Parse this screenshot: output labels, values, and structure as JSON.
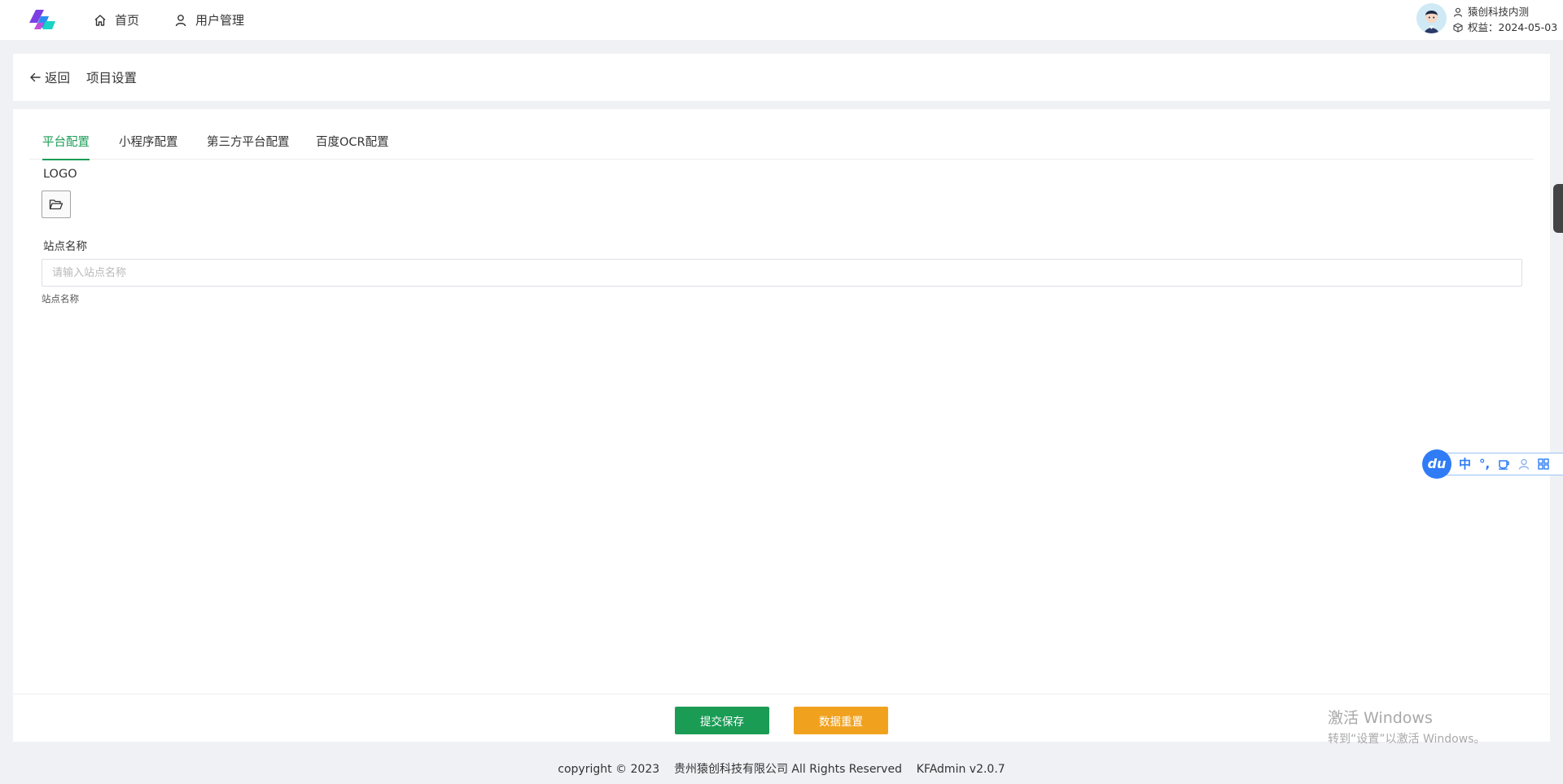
{
  "nav": {
    "home_label": "首页",
    "users_label": "用户管理"
  },
  "user": {
    "name": "猿创科技内测",
    "rights": "权益：2024-05-03"
  },
  "header": {
    "back_label": "返回",
    "title": "项目设置"
  },
  "tabs": [
    {
      "label": "平台配置",
      "active": true
    },
    {
      "label": "小程序配置",
      "active": false
    },
    {
      "label": "第三方平台配置",
      "active": false
    },
    {
      "label": "百度OCR配置",
      "active": false
    }
  ],
  "form": {
    "logo_label": "LOGO",
    "site_name_label": "站点名称",
    "site_name_placeholder": "请输入站点名称",
    "site_name_value": "",
    "site_name_hint": "站点名称"
  },
  "actions": {
    "save_label": "提交保存",
    "reset_label": "数据重置"
  },
  "watermark": {
    "line1": "激活 Windows",
    "line2": "转到“设置”以激活 Windows。"
  },
  "ime": {
    "logo_text": "du",
    "lang": "中",
    "punct": "°,"
  },
  "footer": {
    "copyright": "copyright © 2023    贵州猿创科技有限公司 All Rights Reserved    KFAdmin v2.0.7"
  },
  "colors": {
    "primary": "#1a9c55",
    "warning": "#f0a21f",
    "ime_blue": "#2f7cf6"
  }
}
